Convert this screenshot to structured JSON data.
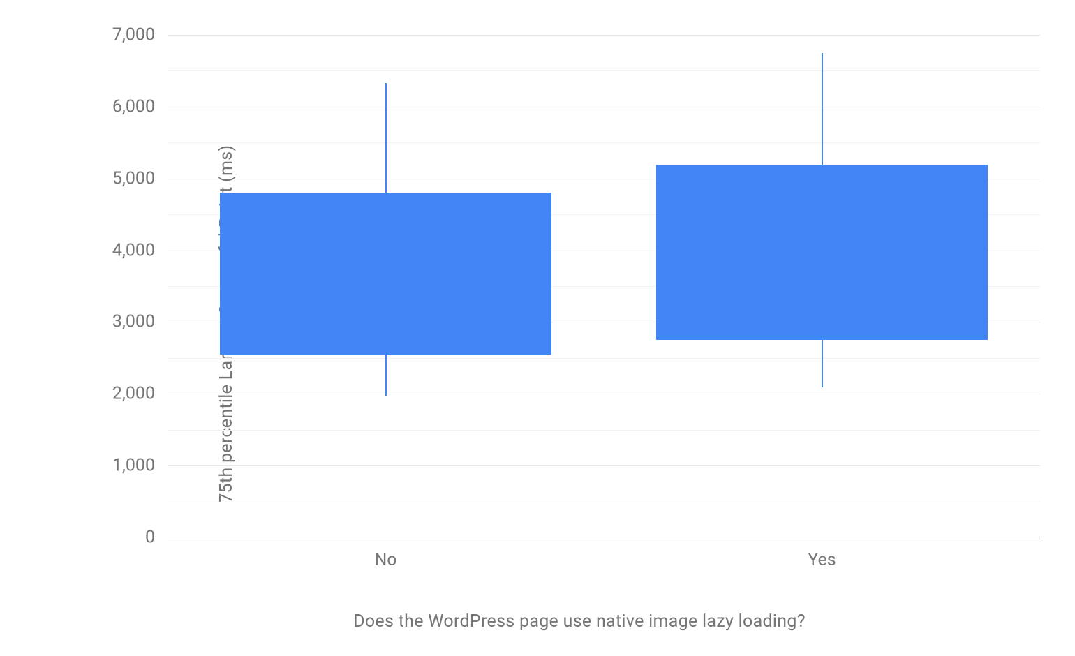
{
  "chart_data": {
    "type": "boxplot",
    "xlabel": "Does the WordPress page use native image lazy loading?",
    "ylabel": "75th percentile Largest Contentful Paint (ms)",
    "categories": [
      "No",
      "Yes"
    ],
    "series": [
      {
        "name": "No",
        "whisker_low": 1970,
        "q1": 2550,
        "q3": 4800,
        "whisker_high": 6330
      },
      {
        "name": "Yes",
        "whisker_low": 2090,
        "q1": 2750,
        "q3": 5190,
        "whisker_high": 6750
      }
    ],
    "ylim": [
      0,
      7000
    ],
    "y_ticks": [
      0,
      1000,
      2000,
      3000,
      4000,
      5000,
      6000,
      7000
    ],
    "y_tick_labels": [
      "0",
      "1,000",
      "2,000",
      "3,000",
      "4,000",
      "5,000",
      "6,000",
      "7,000"
    ],
    "color": "#4285f4"
  }
}
